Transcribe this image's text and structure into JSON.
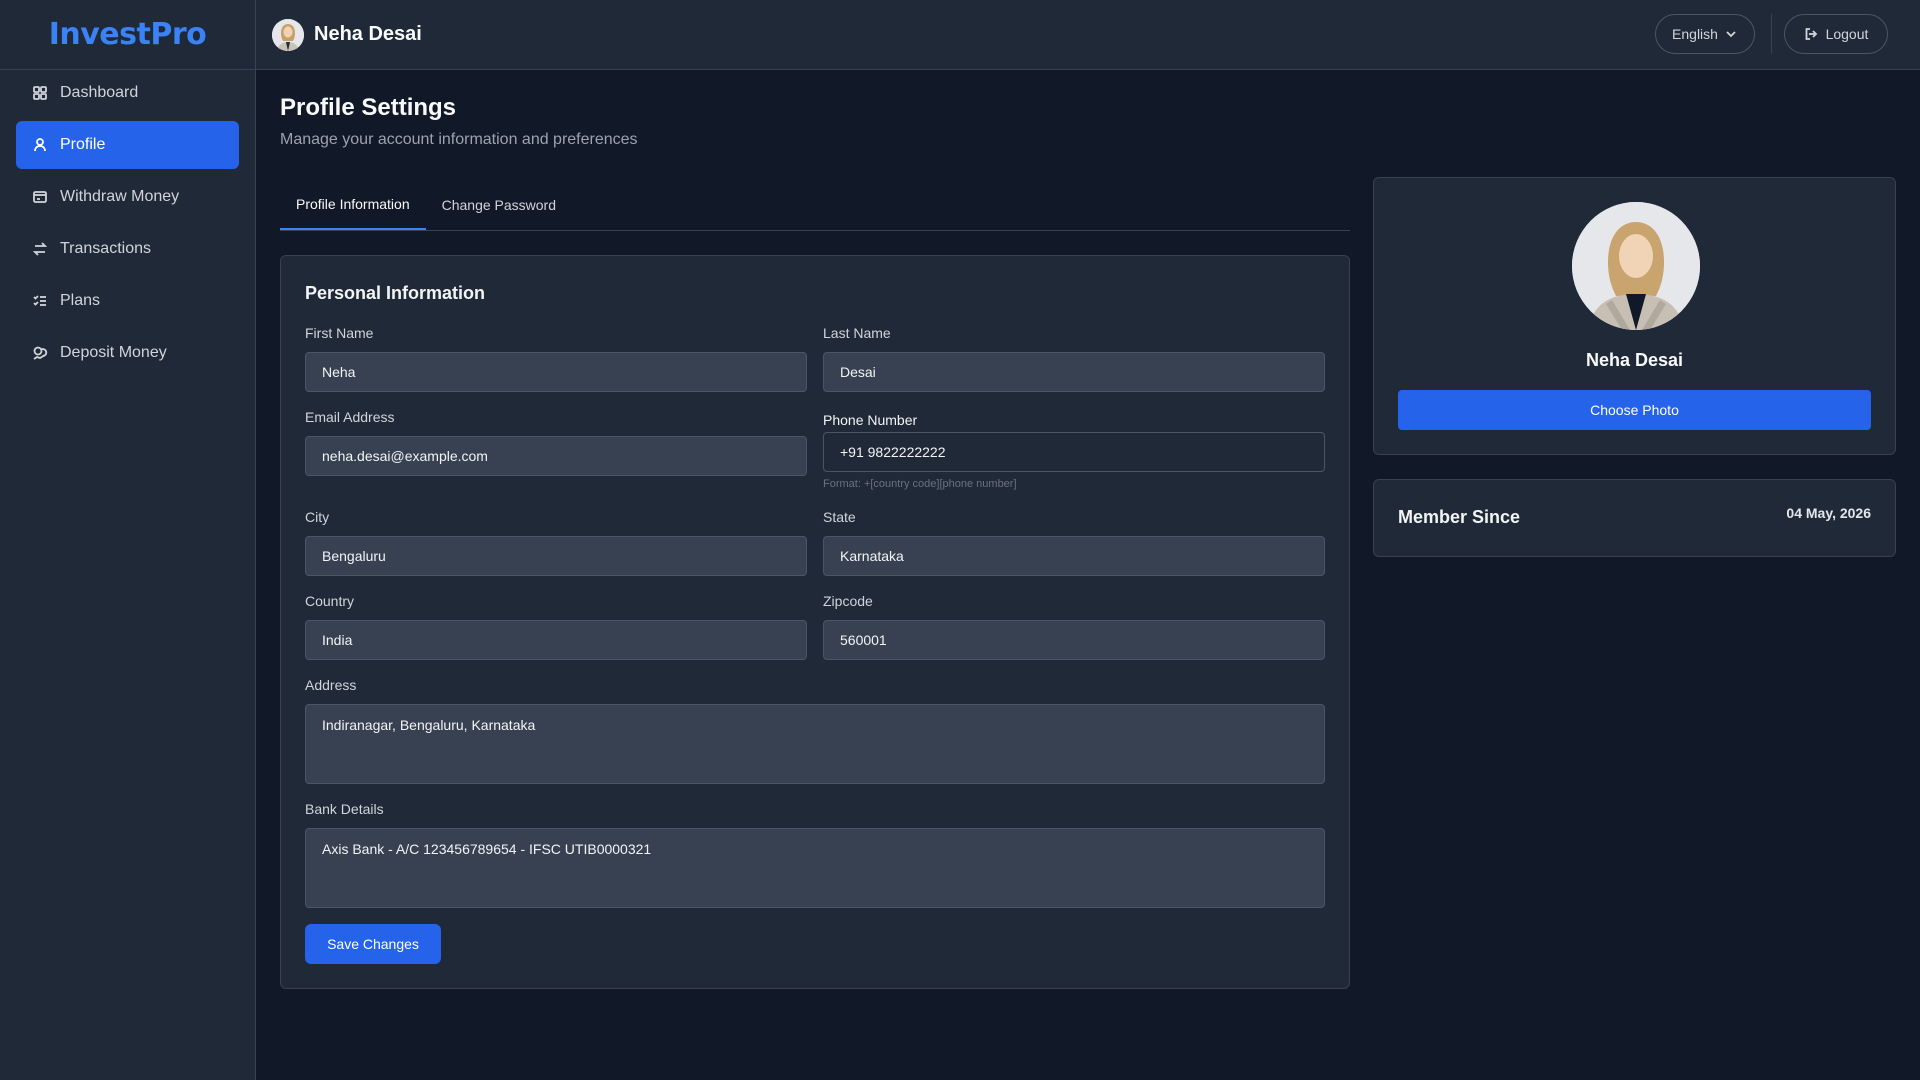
{
  "brand": {
    "name": "InvestPro"
  },
  "sidebar": {
    "items": [
      {
        "label": "Dashboard",
        "icon": "grid-icon",
        "active": false
      },
      {
        "label": "Profile",
        "icon": "user-icon",
        "active": true
      },
      {
        "label": "Withdraw Money",
        "icon": "wallet-icon",
        "active": false
      },
      {
        "label": "Transactions",
        "icon": "arrows-icon",
        "active": false
      },
      {
        "label": "Plans",
        "icon": "list-check-icon",
        "active": false
      },
      {
        "label": "Deposit Money",
        "icon": "coins-icon",
        "active": false
      }
    ]
  },
  "header": {
    "user_name": "Neha Desai",
    "language": "English",
    "logout_label": "Logout"
  },
  "page": {
    "title": "Profile Settings",
    "subtitle": "Manage your account information and preferences"
  },
  "tabs": [
    {
      "label": "Profile Information",
      "active": true
    },
    {
      "label": "Change Password",
      "active": false
    }
  ],
  "form": {
    "section_title": "Personal Information",
    "first_name": {
      "label": "First Name",
      "value": "Neha"
    },
    "last_name": {
      "label": "Last Name",
      "value": "Desai"
    },
    "email": {
      "label": "Email Address",
      "value": "neha.desai@example.com"
    },
    "phone": {
      "label": "Phone Number",
      "value": "+91 9822222222",
      "help": "Format: +[country code][phone number]"
    },
    "city": {
      "label": "City",
      "value": "Bengaluru"
    },
    "state": {
      "label": "State",
      "value": "Karnataka"
    },
    "country": {
      "label": "Country",
      "value": "India"
    },
    "zipcode": {
      "label": "Zipcode",
      "value": "560001"
    },
    "address": {
      "label": "Address",
      "value": "Indiranagar, Bengaluru, Karnataka"
    },
    "bank": {
      "label": "Bank Details",
      "value": "Axis Bank - A/C 123456789654 - IFSC UTIB0000321"
    },
    "save_label": "Save Changes"
  },
  "profile_card": {
    "name": "Neha Desai",
    "choose_photo_label": "Choose Photo"
  },
  "member_card": {
    "label": "Member Since",
    "date": "04 May, 2026"
  },
  "colors": {
    "accent": "#2563eb",
    "background": "#111827",
    "card": "#1f2937"
  }
}
